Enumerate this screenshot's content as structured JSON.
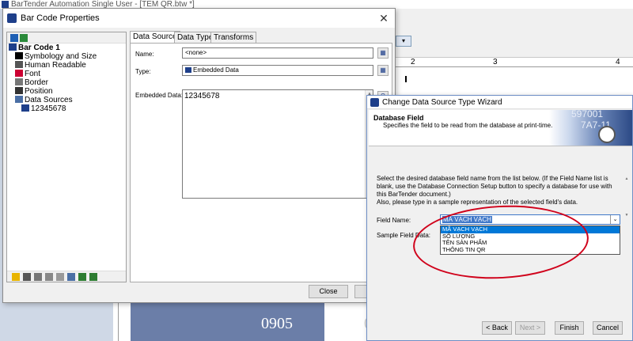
{
  "app": {
    "title": "BarTender Automation Single User - [TEM QR.btw *]",
    "ruler_marks": [
      "2",
      "3",
      "4"
    ],
    "label_text": "0905",
    "label_text_2": "08"
  },
  "bcp": {
    "title": "Bar Code Properties",
    "tree": [
      {
        "label": "Bar Code 1",
        "icon": "barcode-icon",
        "bold": true,
        "indent": 0
      },
      {
        "label": "Symbology and Size",
        "icon": "barcode-bars-icon",
        "bold": false,
        "indent": 1
      },
      {
        "label": "Human Readable",
        "icon": "readable-text-icon",
        "bold": false,
        "indent": 1
      },
      {
        "label": "Font",
        "icon": "font-icon",
        "bold": false,
        "indent": 1
      },
      {
        "label": "Border",
        "icon": "border-icon",
        "bold": false,
        "indent": 1
      },
      {
        "label": "Position",
        "icon": "position-icon",
        "bold": false,
        "indent": 1
      },
      {
        "label": "Data Sources",
        "icon": "data-sources-icon",
        "bold": false,
        "indent": 1
      },
      {
        "label": "12345678",
        "icon": "embedded-data-icon",
        "bold": false,
        "indent": 2
      }
    ],
    "tabs": [
      "Data Source",
      "Data Type",
      "Transforms"
    ],
    "name_label": "Name:",
    "name_value": "<none>",
    "type_label": "Type:",
    "type_value": "Embedded Data",
    "embedded_label": "Embedded Data:",
    "embedded_value": "12345678",
    "close_label": "Close",
    "help_label": "H"
  },
  "wizard": {
    "title": "Change Data Source Type Wizard",
    "header_title": "Database Field",
    "header_desc": "Specifies the field to be read from the database at print-time.",
    "banner_numbers": [
      "597001",
      "7A7-11"
    ],
    "instructions": "Select the desired database field name from the list below. (If the Field Name list is blank, use the Database Connection Setup button to specify a database for use with this BarTender document.)",
    "instructions_2": "Also, please type in a sample representation of the selected field's data.",
    "field_name_label": "Field Name:",
    "field_name_value": "MÃ VẠCH VẠCH",
    "sample_label": "Sample Field Data:",
    "options": [
      "MÃ VẠCH VẠCH",
      "SỐ LƯỢNG",
      "TÊN SẢN PHẨM",
      "THÔNG TIN QR"
    ],
    "back_label": "< Back",
    "next_label": "Next >",
    "finish_label": "Finish",
    "cancel_label": "Cancel"
  },
  "colors": {
    "annotation": "#d0021b",
    "selection": "#0078d7",
    "title_icon": "#1e3f8a"
  }
}
